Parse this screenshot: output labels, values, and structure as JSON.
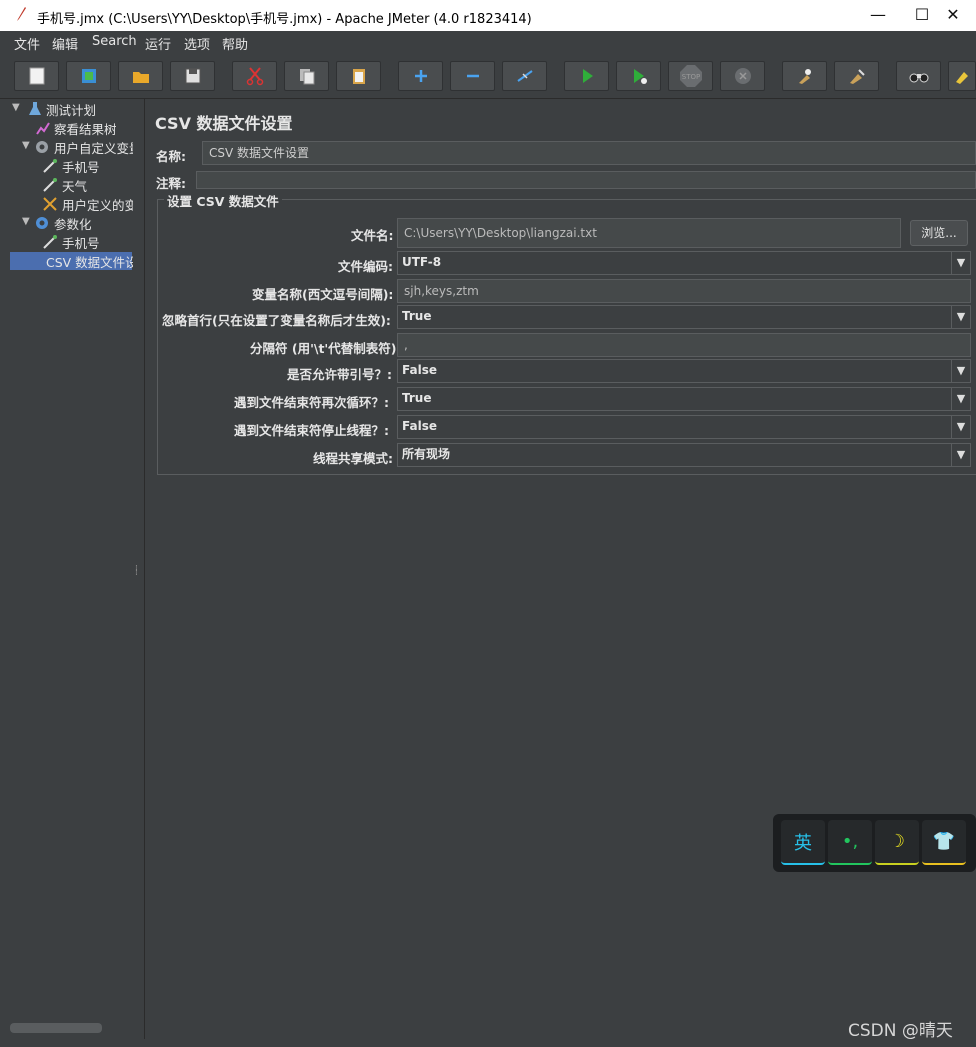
{
  "window": {
    "title": "手机号.jmx (C:\\Users\\YY\\Desktop\\手机号.jmx) - Apache JMeter (4.0 r1823414)",
    "minimize": "—",
    "maximize": "☐",
    "close": "✕"
  },
  "menu": [
    "文件",
    "编辑",
    "Search",
    "运行",
    "选项",
    "帮助"
  ],
  "toolbar": {
    "icons": [
      "new-icon",
      "templates-icon",
      "open-icon",
      "save-icon",
      "cut-icon",
      "copy-icon",
      "paste-icon",
      "expand-icon",
      "collapse-icon",
      "toggle-icon",
      "start-icon",
      "start-no-pause-icon",
      "stop-icon",
      "shutdown-icon",
      "clear-icon",
      "clear-all-icon",
      "search-icon",
      "reset-search-icon"
    ],
    "stop_text": "STOP"
  },
  "tree": {
    "items": [
      {
        "label": "测试计划",
        "icon": "flask-icon"
      },
      {
        "label": "察看结果树",
        "icon": "chart-icon"
      },
      {
        "label": "用户自定义变量",
        "icon": "gear-icon"
      },
      {
        "label": "手机号",
        "icon": "sampler-icon"
      },
      {
        "label": "天气",
        "icon": "sampler-icon"
      },
      {
        "label": "用户定义的变量",
        "icon": "tools-icon"
      },
      {
        "label": "参数化",
        "icon": "gear-icon"
      },
      {
        "label": "手机号",
        "icon": "sampler-icon"
      },
      {
        "label": "CSV 数据文件设置",
        "icon": "tools-icon"
      }
    ]
  },
  "panel": {
    "title": "CSV 数据文件设置",
    "name_label": "名称:",
    "name_value": "CSV 数据文件设置",
    "comment_label": "注释:",
    "group_title": "设置 CSV 数据文件",
    "file_label": "文件名:",
    "file_value": "C:\\Users\\YY\\Desktop\\liangzai.txt",
    "browse_label": "浏览...",
    "encoding_label": "文件编码:",
    "encoding_value": "UTF-8",
    "varnames_label": "变量名称(西文逗号间隔):",
    "varnames_value": "sjh,keys,ztm",
    "ignore_first_label": "忽略首行(只在设置了变量名称后才生效):",
    "ignore_first_value": "True",
    "delimiter_label": "分隔符 (用'\\t'代替制表符):",
    "delimiter_value": ",",
    "quoted_label": "是否允许带引号？:",
    "quoted_value": "False",
    "recycle_label": "遇到文件结束符再次循环？:",
    "recycle_value": "True",
    "stop_thread_label": "遇到文件结束符停止线程？:",
    "stop_thread_value": "False",
    "share_mode_label": "线程共享模式:",
    "share_mode_value": "所有现场"
  },
  "ime": {
    "lang": "英",
    "punct": "•,",
    "moon": "☽",
    "shirt": "👕"
  },
  "watermark": "CSDN @晴天"
}
